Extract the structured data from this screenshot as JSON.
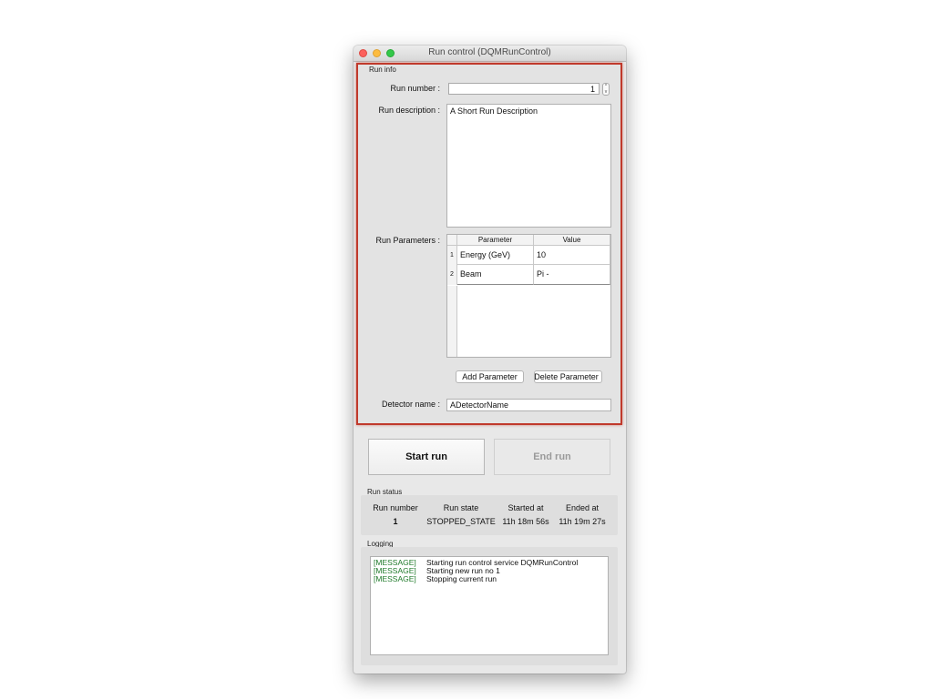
{
  "window": {
    "title": "Run control (DQMRunControl)"
  },
  "run_info": {
    "group_label": "Run info",
    "run_number_label": "Run number :",
    "run_number_value": "1",
    "spin_up": "^",
    "spin_down": "v",
    "run_description_label": "Run description :",
    "run_description_value": "A Short Run Description",
    "run_parameters_label": "Run Parameters :",
    "parameters_table": {
      "headers": [
        "Parameter",
        "Value"
      ],
      "rows": [
        {
          "index": "1",
          "parameter": "Energy (GeV)",
          "value": "10"
        },
        {
          "index": "2",
          "parameter": "Beam",
          "value": "Pi -"
        }
      ]
    },
    "add_parameter_label": "Add Parameter",
    "delete_parameter_label": "Delete Parameter",
    "detector_name_label": "Detector name :",
    "detector_name_value": "ADetectorName"
  },
  "actions": {
    "start_run_label": "Start run",
    "end_run_label": "End run"
  },
  "run_status": {
    "group_label": "Run status",
    "headers": [
      "Run number",
      "Run state",
      "Started at",
      "Ended at"
    ],
    "values": [
      "1",
      "STOPPED_STATE",
      "11h 18m 56s",
      "11h 19m 27s"
    ]
  },
  "logging": {
    "group_label": "Logging",
    "entries": [
      {
        "tag": "[MESSAGE]",
        "text": "Starting run control service DQMRunControl"
      },
      {
        "tag": "[MESSAGE]",
        "text": "Starting new run no 1"
      },
      {
        "tag": "[MESSAGE]",
        "text": "Stopping current run"
      }
    ],
    "tag_color": "#1f7a2a"
  },
  "colors": {
    "highlight_border": "#c0392b",
    "close": "#fc615d",
    "minimize": "#fdbc40",
    "maximize": "#34c84a"
  }
}
